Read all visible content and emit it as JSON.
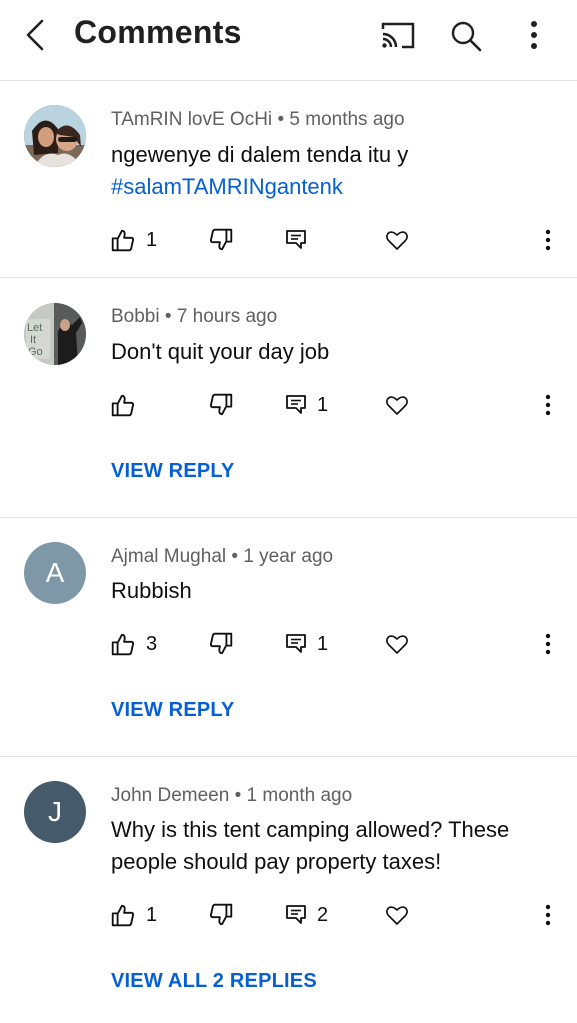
{
  "header": {
    "title": "Comments"
  },
  "comments": [
    {
      "author": "TAmRIN lovE OcHi",
      "time": "5 months ago",
      "text": "ngewenye di dalem tenda itu y",
      "hashtag": "#salamTAMRINgantenk",
      "likes": "1",
      "replies": ""
    },
    {
      "author": "Bobbi",
      "time": "7 hours ago",
      "text": "Don't quit your day job",
      "likes": "",
      "replies": "1",
      "view_replies": "VIEW REPLY",
      "avatar_text": "Let It Go"
    },
    {
      "author": "Ajmal Mughal",
      "time": "1 year ago",
      "text": "Rubbish",
      "likes": "3",
      "replies": "1",
      "view_replies": "VIEW REPLY",
      "avatar_letter": "A",
      "avatar_color": "#7f98a8"
    },
    {
      "author": "John Demeen",
      "time": "1 month ago",
      "text_line1": "Why is this tent camping allowed? These",
      "text_line2": "people should pay property taxes!",
      "likes": "1",
      "replies": "2",
      "view_replies": "VIEW ALL 2 REPLIES",
      "avatar_letter": "J",
      "avatar_color": "#455a6b"
    }
  ],
  "separator": "•",
  "colors": {
    "link": "#065fd4",
    "meta": "#606060",
    "divider": "#e3e3e3"
  }
}
